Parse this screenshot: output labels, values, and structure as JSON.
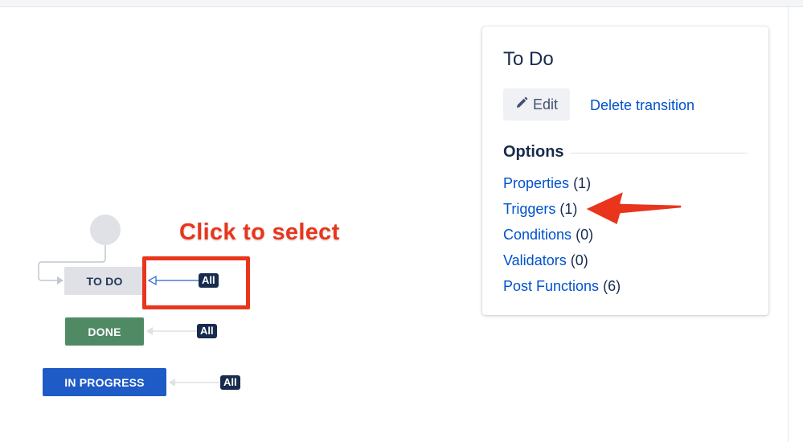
{
  "panel": {
    "title": "To Do",
    "edit_label": "Edit",
    "delete_label": "Delete transition",
    "options_heading": "Options",
    "options": [
      {
        "label": "Properties",
        "count": "(1)"
      },
      {
        "label": "Triggers",
        "count": "(1)"
      },
      {
        "label": "Conditions",
        "count": "(0)"
      },
      {
        "label": "Validators",
        "count": "(0)"
      },
      {
        "label": "Post Functions",
        "count": "(6)"
      }
    ]
  },
  "diagram": {
    "statuses": [
      {
        "label": "TO DO",
        "color": "#dfe1e6"
      },
      {
        "label": "DONE",
        "color": "#4f8a65"
      },
      {
        "label": "IN PROGRESS",
        "color": "#1f5bc6"
      }
    ],
    "transition_badge": "All"
  },
  "annotation": {
    "callout": "Click to select",
    "color": "#e8351c"
  },
  "icons": {
    "edit": "pencil-icon"
  }
}
